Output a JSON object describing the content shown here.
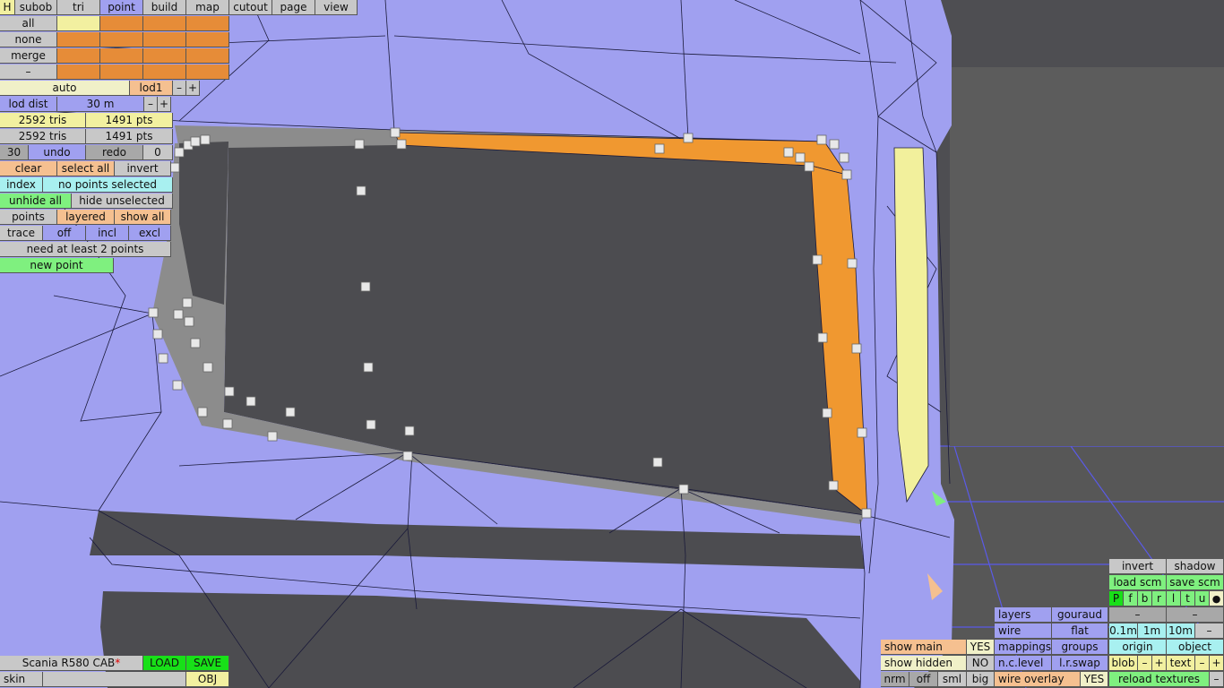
{
  "tabs": [
    {
      "label": "H",
      "active": false
    },
    {
      "label": "subob",
      "active": false
    },
    {
      "label": "tri",
      "active": false
    },
    {
      "label": "point",
      "active": true
    },
    {
      "label": "build",
      "active": false
    },
    {
      "label": "map",
      "active": false
    },
    {
      "label": "cutout",
      "active": false
    },
    {
      "label": "page",
      "active": false
    },
    {
      "label": "view",
      "active": false
    }
  ],
  "selection_rows": [
    "all",
    "none",
    "merge",
    "–"
  ],
  "lod": {
    "auto": "auto",
    "level": "lod1",
    "minus": "–",
    "plus": "+",
    "dist_label": "lod dist",
    "dist_value": "30 m"
  },
  "stats": {
    "tris_1": "2592 tris",
    "pts_1": "1491 pts",
    "tris_2": "2592 tris",
    "pts_2": "1491 pts"
  },
  "history": {
    "count": "30",
    "undo": "undo",
    "redo": "redo",
    "redo_count": "0"
  },
  "actions": {
    "clear": "clear",
    "select_all": "select all",
    "invert": "invert",
    "index": "index",
    "no_points": "no points selected",
    "unhide_all": "unhide all",
    "hide_unselected": "hide unselected",
    "points": "points",
    "layered": "layered",
    "show_all": "show all",
    "trace": "trace",
    "off": "off",
    "incl": "incl",
    "excl": "excl",
    "need_points": "need at least 2 points",
    "new_point": "new point"
  },
  "file": {
    "name": "Scania R580 CAB",
    "modified_mark": "*",
    "load": "LOAD",
    "save": "SAVE",
    "skin_label": "skin",
    "obj": "OBJ"
  },
  "view_bottom": {
    "show_main": "show main",
    "show_main_value": "YES",
    "show_hidden": "show hidden",
    "show_hidden_value": "NO",
    "nrm": "nrm",
    "off": "off",
    "sml": "sml",
    "big": "big"
  },
  "render": {
    "layers": "layers",
    "gouraud": "gouraud",
    "wire": "wire",
    "flat": "flat",
    "mappings": "mappings",
    "groups": "groups",
    "nc_level": "n.c.level",
    "lr_swap": "l.r.swap",
    "wire_overlay": "wire overlay",
    "wire_overlay_value": "YES"
  },
  "right_panel": {
    "invert": "invert",
    "shadow": "shadow",
    "load_scm": "load scm",
    "save_scm": "save scm",
    "channels": [
      "P",
      "f",
      "b",
      "r",
      "l",
      "t",
      "u"
    ],
    "dot": "●",
    "dash": "–",
    "scale_01": "0.1m",
    "scale_1": "1m",
    "scale_10": "10m",
    "origin": "origin",
    "object": "object",
    "blob": "blob",
    "text": "text",
    "plus": "+",
    "reload_textures": "reload textures"
  },
  "colors": {
    "mesh": "#a0a0f0",
    "selected_face": "#f09830",
    "highlight_face": "#f2f09c",
    "inner_rim": "#8a8a8a",
    "background": "#4e4e52",
    "floor": "#5a5a5a",
    "grid": "#5a5ae8"
  },
  "icons": {
    "vertex_handle": "vertex-handle-icon",
    "modified": "asterisk-icon",
    "dot": "dot-icon"
  }
}
